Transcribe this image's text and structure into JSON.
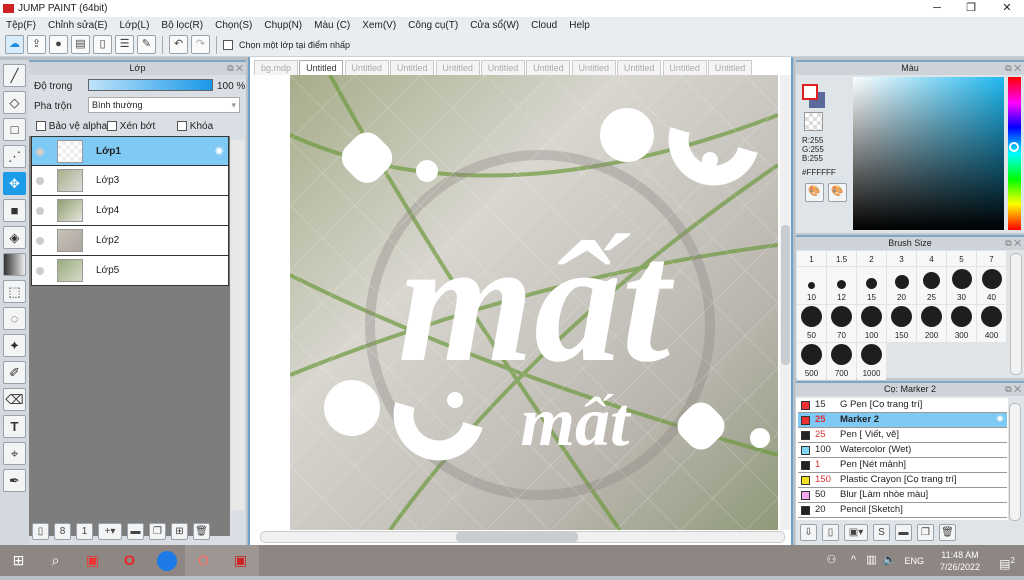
{
  "app": {
    "title": "JUMP PAINT (64bit)"
  },
  "menu": [
    "Tệp(F)",
    "Chỉnh sửa(E)",
    "Lớp(L)",
    "Bộ lọc(R)",
    "Chọn(S)",
    "Chụp(N)",
    "Màu (C)",
    "Xem(V)",
    "Công cụ(T)",
    "Cửa sổ(W)",
    "Cloud",
    "Help"
  ],
  "toolbar": {
    "checkbox_label": "Chọn một lớp tại điểm nhấp"
  },
  "layers_panel": {
    "title": "Lớp",
    "opacity_label": "Độ trong",
    "opacity_value": "100 %",
    "opacity_percent": 100,
    "blend_label": "Pha trộn",
    "blend_value": "Bình thường",
    "protect_alpha": "Bảo vệ alpha",
    "clipping": "Xén bớt",
    "lock": "Khóa",
    "layers": [
      {
        "name": "Lớp1",
        "selected": true
      },
      {
        "name": "Lớp3"
      },
      {
        "name": "Lớp4"
      },
      {
        "name": "Lớp2"
      },
      {
        "name": "Lớp5"
      }
    ]
  },
  "tabs": [
    "bg.mdp",
    "Untitled",
    "Untitled",
    "Untitled",
    "Untitled",
    "Untitled",
    "Untitled",
    "Untitled",
    "Untitled",
    "Untitled",
    "Untitled"
  ],
  "active_tab": 1,
  "canvas": {
    "big_text": "mất",
    "small_text": "mất"
  },
  "color_panel": {
    "title": "Màu",
    "r": "R:255",
    "g": "G:255",
    "b": "B:255",
    "hex": "#FFFFFF",
    "fg_color": "#FFFFFF",
    "bg_color": "#5a6a9a",
    "hue_color": "#1fb8f0"
  },
  "brush_size_panel": {
    "title": "Brush Size",
    "top_labels": [
      "1",
      "1.5",
      "2",
      "3",
      "4",
      "5",
      "7"
    ],
    "sizes": [
      [
        "10",
        7
      ],
      [
        "12",
        9
      ],
      [
        "15",
        11
      ],
      [
        "20",
        14
      ],
      [
        "25",
        17
      ],
      [
        "30",
        20
      ],
      [
        "40",
        20
      ],
      [
        "50",
        21
      ],
      [
        "70",
        21
      ],
      [
        "100",
        21
      ],
      [
        "150",
        21
      ],
      [
        "200",
        21
      ],
      [
        "300",
        21
      ],
      [
        "400",
        21
      ],
      [
        "500",
        21
      ],
      [
        "700",
        21
      ],
      [
        "1000",
        21
      ]
    ]
  },
  "brush_panel": {
    "title": "Cọ: Marker 2",
    "brushes": [
      {
        "size": "15",
        "name": "G Pen [Cọ trang trí]",
        "color": "#f03030",
        "size_red": false
      },
      {
        "size": "25",
        "name": "Marker 2",
        "color": "#f03030",
        "size_red": true,
        "selected": true
      },
      {
        "size": "25",
        "name": "Pen [ Viết, vẽ]",
        "color": "#222222",
        "size_red": true
      },
      {
        "size": "100",
        "name": "Watercolor (Wet)",
        "color": "#80d8f8",
        "size_red": false
      },
      {
        "size": "1",
        "name": "Pen [Nét mảnh]",
        "color": "#222222",
        "size_red": true
      },
      {
        "size": "150",
        "name": "Plastic Crayon [Cọ trang trí]",
        "color": "#f0e020",
        "size_red": true
      },
      {
        "size": "50",
        "name": "Blur [Làm nhòe màu]",
        "color": "#f4a8f0",
        "size_red": false
      },
      {
        "size": "20",
        "name": "Pencil [Sketch]",
        "color": "#222222",
        "size_red": false
      }
    ]
  },
  "taskbar": {
    "time": "11:48 AM",
    "date": "7/26/2022",
    "lang": "ENG",
    "notifications": "2"
  }
}
